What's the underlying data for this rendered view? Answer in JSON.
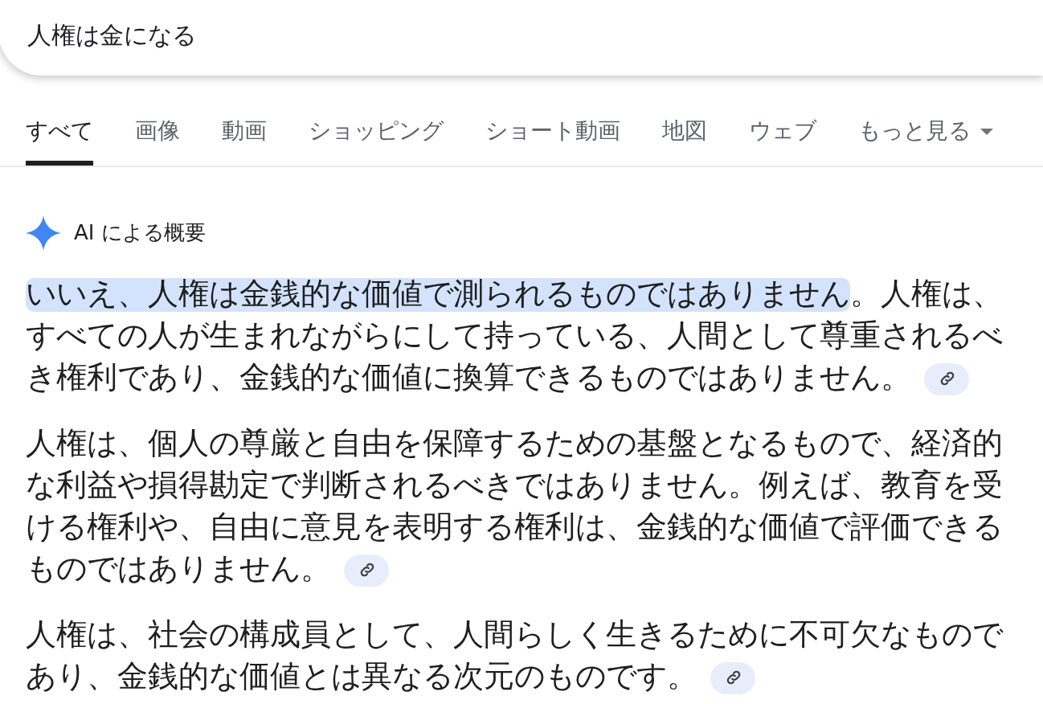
{
  "search": {
    "value": "人権は金になる"
  },
  "tabs": [
    {
      "label": "すべて",
      "selected": true
    },
    {
      "label": "画像",
      "selected": false
    },
    {
      "label": "動画",
      "selected": false
    },
    {
      "label": "ショッピング",
      "selected": false
    },
    {
      "label": "ショート動画",
      "selected": false
    },
    {
      "label": "地図",
      "selected": false
    },
    {
      "label": "ウェブ",
      "selected": false
    },
    {
      "label": "もっと見る",
      "selected": false,
      "kind": "menu"
    }
  ],
  "ai_overview": {
    "title": "AI による概要",
    "paragraphs": [
      {
        "highlight": "いいえ、人権は金銭的な価値で測られるものではありません",
        "text": "。人権は、すべての人が生まれながらにして持っている、人間として尊重されるべき権利であり、金銭的な価値に換算できるものではありません。"
      },
      {
        "text": "人権は、個人の尊厳と自由を保障するための基盤となるもので、経済的な利益や損得勘定で判断されるべきではありません。例えば、教育を受ける権利や、自由に意見を表明する権利は、金銭的な価値で評価できるものではありません。"
      },
      {
        "text": "人権は、社会の構成員として、人間らしく生きるために不可欠なものであり、金銭的な価値とは異なる次元のものです。"
      }
    ]
  }
}
